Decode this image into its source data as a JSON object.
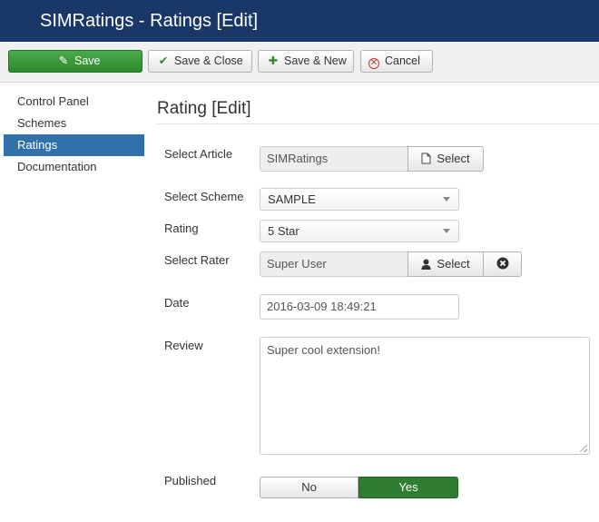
{
  "header": {
    "title": "SIMRatings - Ratings [Edit]"
  },
  "toolbar": {
    "save_label": "Save",
    "save_close_label": "Save & Close",
    "save_new_label": "Save & New",
    "cancel_label": "Cancel"
  },
  "sidebar": {
    "items": [
      {
        "label": "Control Panel",
        "active": false
      },
      {
        "label": "Schemes",
        "active": false
      },
      {
        "label": "Ratings",
        "active": true
      },
      {
        "label": "Documentation",
        "active": false
      }
    ]
  },
  "page": {
    "title": "Rating [Edit]"
  },
  "form": {
    "article": {
      "label": "Select Article",
      "value": "SIMRatings",
      "button_label": "Select"
    },
    "scheme": {
      "label": "Select Scheme",
      "value": "SAMPLE"
    },
    "rating": {
      "label": "Rating",
      "value": "5 Star"
    },
    "rater": {
      "label": "Select Rater",
      "value": "Super User",
      "button_label": "Select"
    },
    "date": {
      "label": "Date",
      "value": "2016-03-09 18:49:21"
    },
    "review": {
      "label": "Review",
      "value": "Super cool extension!"
    },
    "published": {
      "label": "Published",
      "options": [
        "No",
        "Yes"
      ],
      "selected": "Yes"
    }
  },
  "colors": {
    "header_bg": "#1a3867",
    "save_green": "#2c8a2c",
    "active_blue": "#3071a9",
    "published_green": "#2f7d32",
    "cancel_red": "#bd362f"
  }
}
